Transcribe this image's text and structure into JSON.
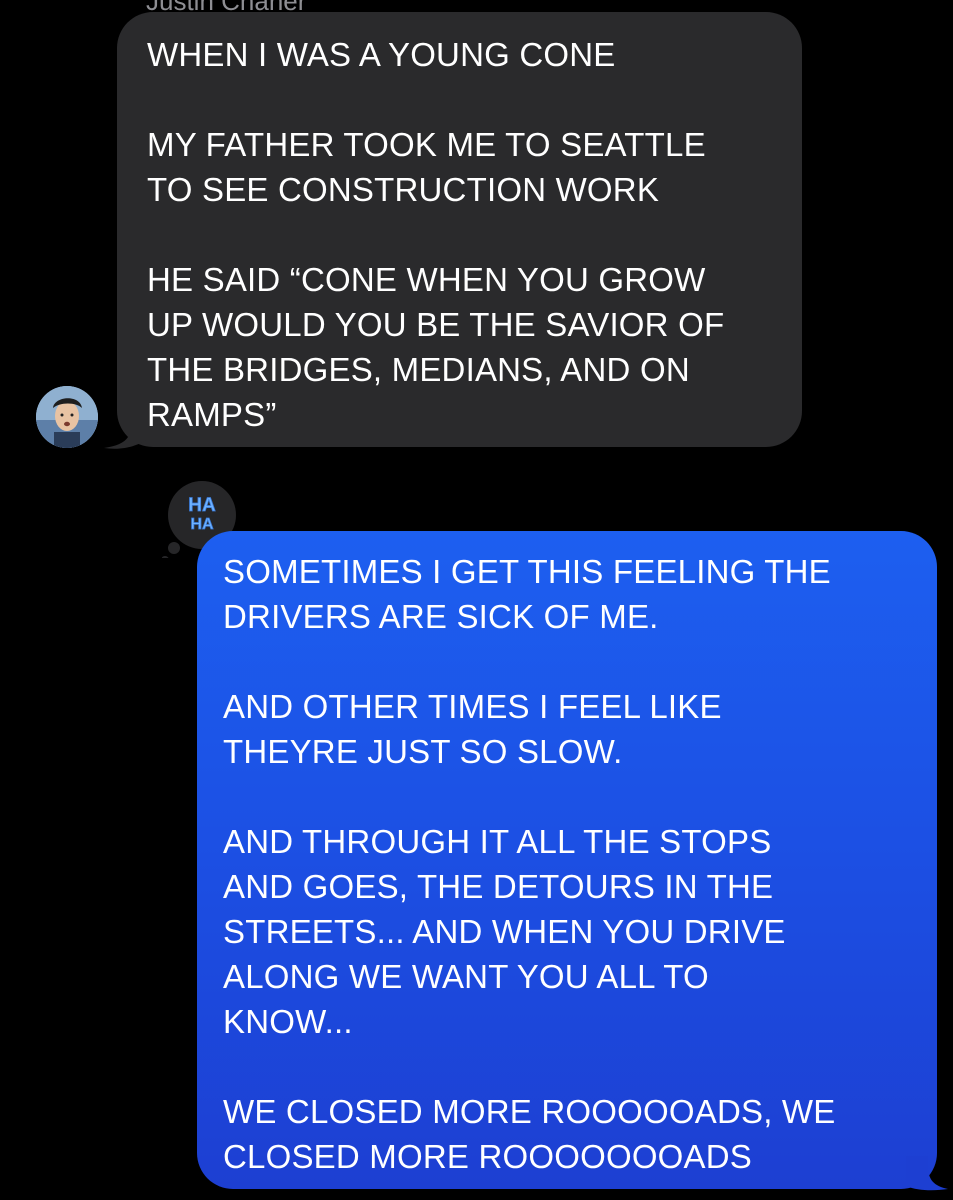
{
  "conversation": {
    "sender_name": "Justin Chaner",
    "incoming": {
      "text": "WHEN I WAS A YOUNG CONE\n\nMY FATHER TOOK ME TO SEATTLE\nTO SEE CONSTRUCTION WORK\n\nHE SAID “CONE WHEN YOU GROW\nUP WOULD YOU BE THE SAVIOR OF\nTHE BRIDGES, MEDIANS, AND ON\nRAMPS”",
      "bubble_color": "#2a2a2c"
    },
    "tapback": {
      "label_top": "HA",
      "label_bottom": "HA",
      "icon": "haha-tapback-icon",
      "text_color": "#6fb3ff"
    },
    "outgoing": {
      "text": "SOMETIMES I GET THIS FEELING THE\nDRIVERS ARE SICK OF ME.\n\nAND OTHER TIMES I FEEL LIKE\nTHEYRE JUST SO SLOW.\n\nAND THROUGH IT ALL THE STOPS\nAND GOES, THE DETOURS IN THE\nSTREETS... AND WHEN YOU DRIVE\nALONG WE WANT YOU ALL TO\nKNOW...\n\nWE CLOSED MORE ROOOOOADS, WE\nCLOSED MORE ROOOOOOOADS",
      "bubble_color": "#1d4fe3"
    }
  }
}
